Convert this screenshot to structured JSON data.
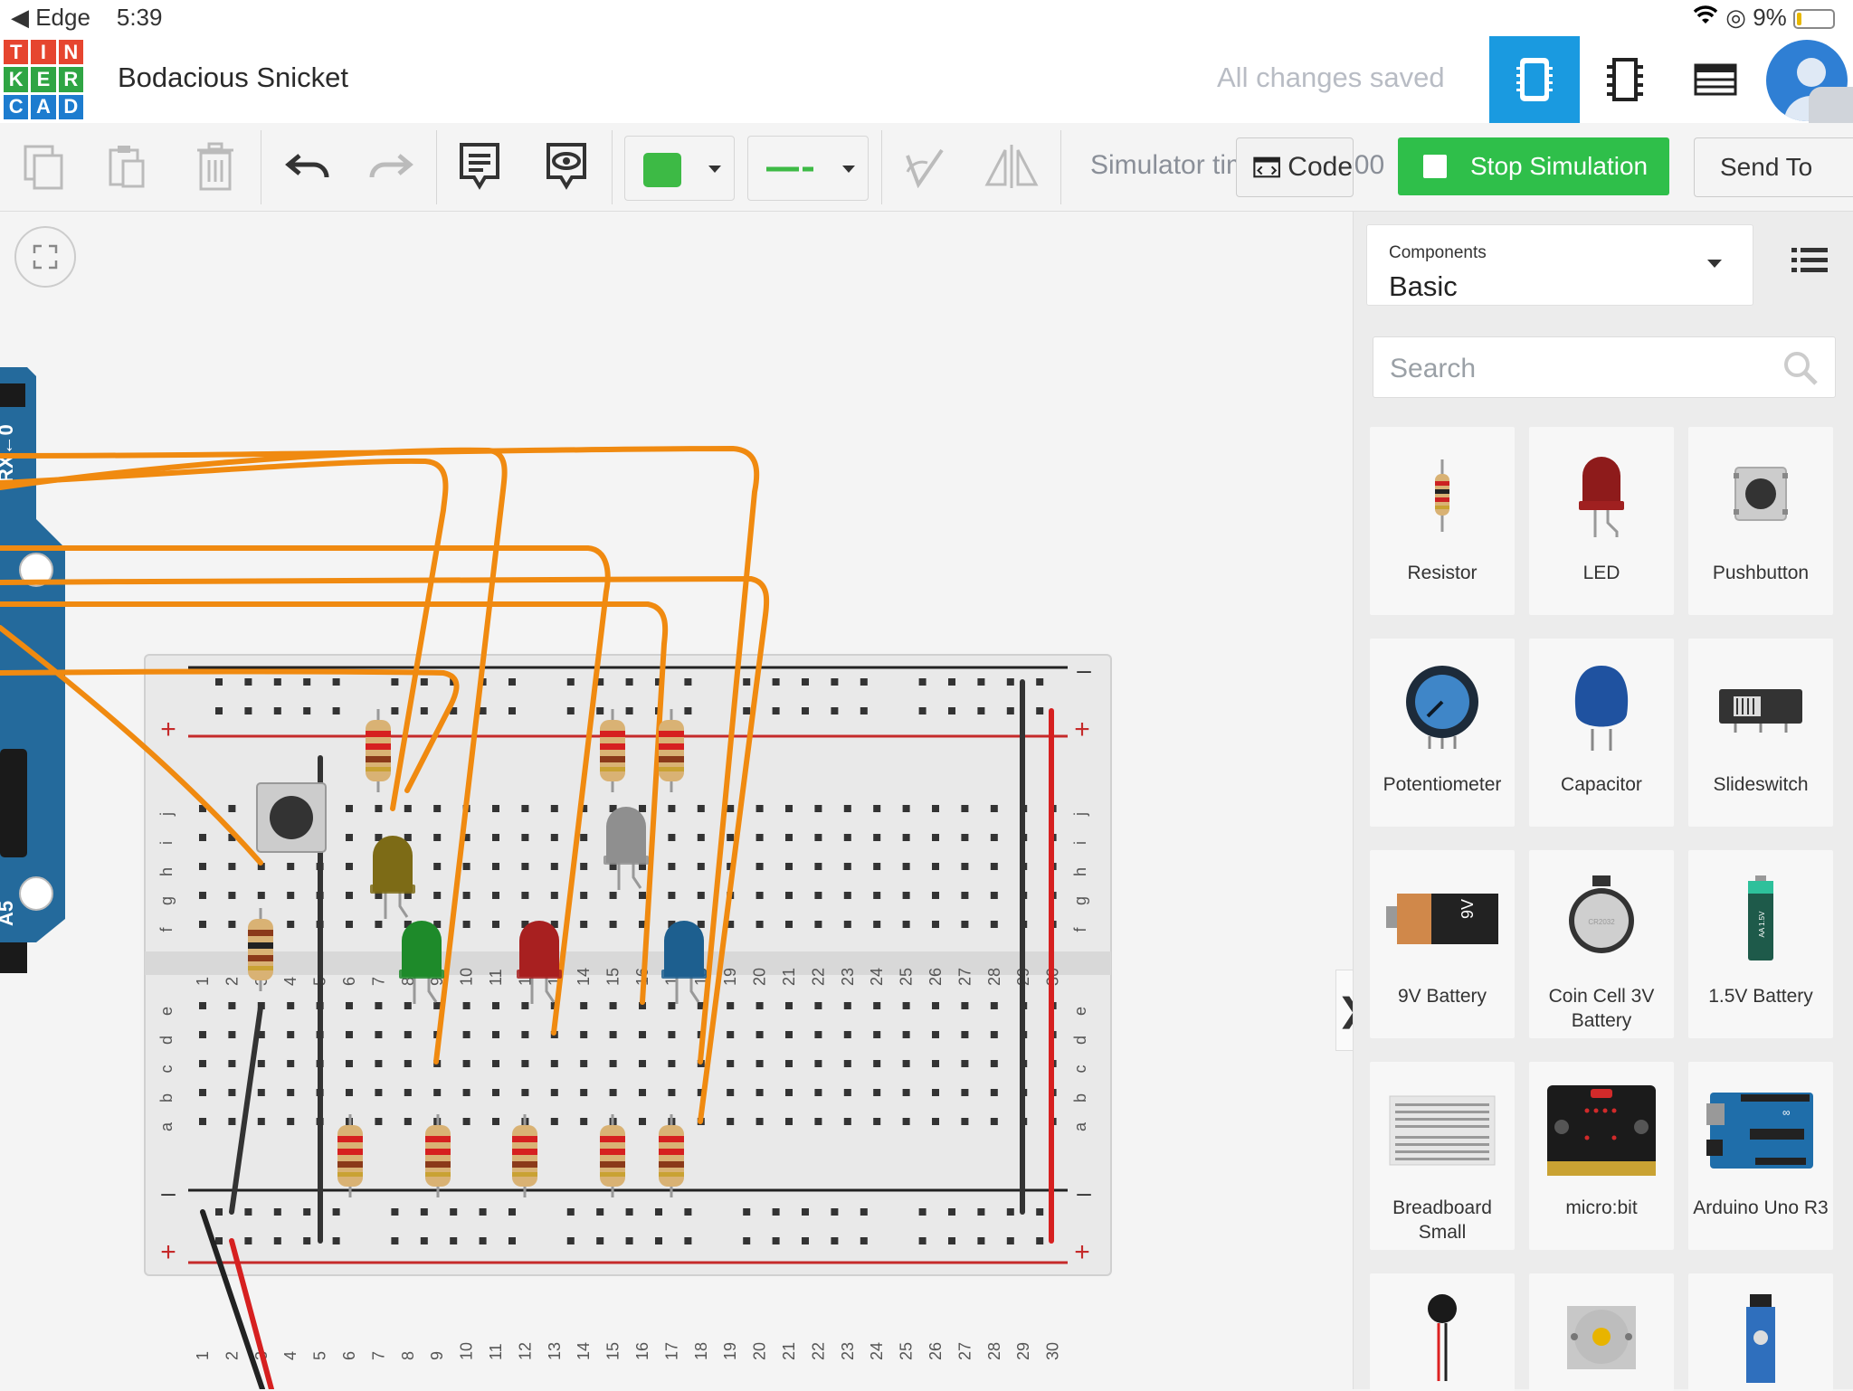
{
  "statusbar": {
    "back_app": "◀ Edge",
    "time": "5:39",
    "battery": "9%"
  },
  "logo": {
    "letters": [
      "T",
      "I",
      "N",
      "K",
      "E",
      "R",
      "C",
      "A",
      "D"
    ],
    "colors": [
      "#e6452f",
      "#e6452f",
      "#e6452f",
      "#2fa544",
      "#2fa544",
      "#2fa544",
      "#1d7ccf",
      "#1d7ccf",
      "#1d7ccf"
    ]
  },
  "header": {
    "title": "Bodacious Snicket",
    "save_status": "All changes saved"
  },
  "toolbar": {
    "simulator_timer": "Simulator time: 00:00:00",
    "code_label": "Code",
    "stop_label": "Stop Simulation",
    "send_label": "Send To",
    "wire_color": "#3dba45"
  },
  "canvas": {
    "breadboard_rows_top": [
      "j",
      "i",
      "h",
      "g",
      "f"
    ],
    "breadboard_rows_bottom": [
      "e",
      "d",
      "c",
      "b",
      "a"
    ],
    "columns": [
      "1",
      "2",
      "3",
      "4",
      "5",
      "6",
      "7",
      "8",
      "9",
      "10",
      "11",
      "12",
      "13",
      "14",
      "15",
      "16",
      "17",
      "18",
      "19",
      "20",
      "21",
      "22",
      "23",
      "24",
      "25",
      "26",
      "27",
      "28",
      "29",
      "30"
    ],
    "rail_minus": "–",
    "rail_plus": "+",
    "arduino_labels": [
      "RX←0",
      "A5"
    ]
  },
  "panel": {
    "components_label": "Components",
    "components_value": "Basic",
    "search_placeholder": "Search",
    "items": [
      {
        "name": "Resistor",
        "icon": "resistor-icon"
      },
      {
        "name": "LED",
        "icon": "led-icon"
      },
      {
        "name": "Pushbutton",
        "icon": "pushbutton-icon"
      },
      {
        "name": "Potentiometer",
        "icon": "potentiometer-icon"
      },
      {
        "name": "Capacitor",
        "icon": "capacitor-icon"
      },
      {
        "name": "Slideswitch",
        "icon": "slideswitch-icon"
      },
      {
        "name": "9V Battery",
        "icon": "battery-9v-icon"
      },
      {
        "name": "Coin Cell 3V Battery",
        "icon": "coin-cell-icon"
      },
      {
        "name": "1.5V Battery",
        "icon": "battery-aa-icon"
      },
      {
        "name": "Breadboard Small",
        "icon": "breadboard-icon"
      },
      {
        "name": "micro:bit",
        "icon": "microbit-icon"
      },
      {
        "name": "Arduino Uno R3",
        "icon": "arduino-icon"
      }
    ]
  }
}
